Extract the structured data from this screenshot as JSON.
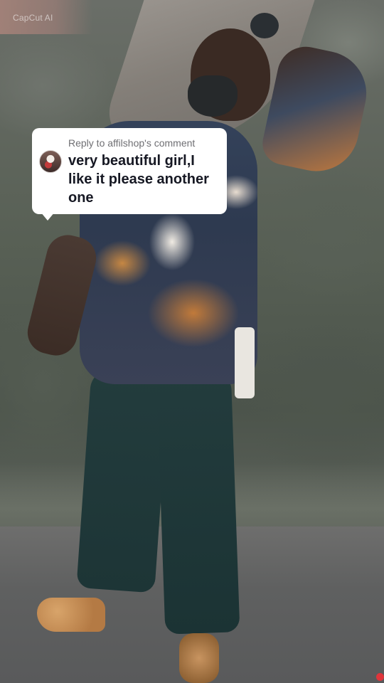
{
  "watermark": {
    "text": "CapCut AI"
  },
  "reply_card": {
    "header": "Reply to affilshop's comment",
    "comment": "very beautiful girl,I like it please another one",
    "avatar_icon": "user-avatar",
    "background_color": "#ffffff",
    "text_color": "#161823",
    "header_color": "#6f6f73"
  },
  "indicators": {
    "corner_dot_color": "#e0353b"
  }
}
